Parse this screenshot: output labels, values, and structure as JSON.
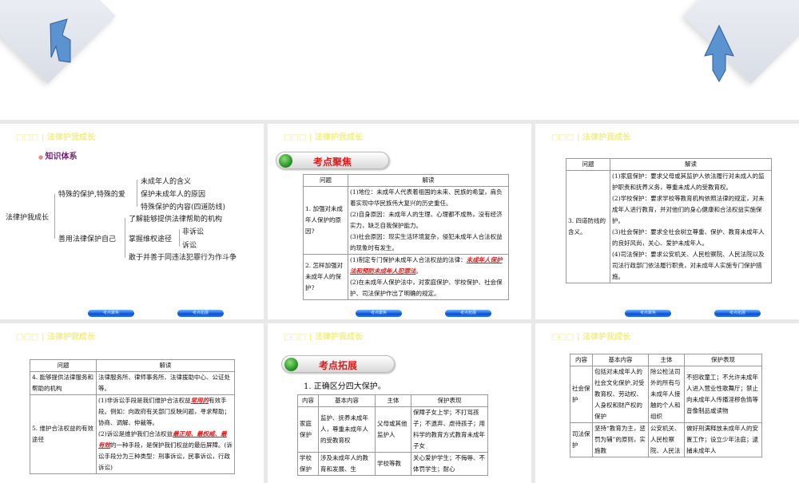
{
  "header": "□□□ | 法律护我成长",
  "nav": {
    "prev": "考点聚焦",
    "next": "考点拓展"
  },
  "slide1": {
    "section": "知识体系",
    "root": "法律护我成长",
    "b1": "特殊的保护,特殊的爱",
    "b1_items": [
      "未成年人的含义",
      "保护未成年人的原因",
      "特殊保护的内容(四道防线)"
    ],
    "b2": "善用法律保护自己",
    "b2_items": [
      "了解能够提供法律帮助的机构",
      "掌握维权途径",
      "敢于并善于同违法犯罪行为作斗争"
    ],
    "b2_sub": [
      "非诉讼",
      "诉讼"
    ]
  },
  "slide2": {
    "banner": "考点聚焦",
    "head": [
      "问题",
      "解读"
    ],
    "r1q": "1. 加强对未成年人保护的原因?",
    "r1a": [
      "(1)地位：未成年人代表着祖国的未来、民族的希望，肩负着实现中华民族伟大复兴的历史重任。",
      "(2)自身原因：未成年人的生理、心理都不成熟，没有经济实力，缺乏自我保护能力。",
      "(3)社会原因：现实生活环境复杂，侵犯未成年人合法权益的现象时有发生。"
    ],
    "r2q": "2. 怎样加强对未成年人的保护?",
    "r2a1": "(1)制定专门保护未成年人合法权益的法律：",
    "r2a1_red": "未成年人保护法和预防未成年人犯罪法",
    "r2a1_end": "。",
    "r2a2": "(2)在未成年人保护法中，对家庭保护、学校保护、社会保护、司法保护作出了明确的规定。"
  },
  "slide3": {
    "head": [
      "问题",
      "解读"
    ],
    "q": "3. 四道防线的含义。",
    "a": [
      "(1)家庭保护：要求父母或其监护人依法履行对未成人的监护职责和抚养义务，尊重未成人的受教育权。",
      "(2)学校保护：要求学校等教育机构依照法律的规定，对未成年人进行教育，并对他们的身心健康和合法权益实施保护。",
      "(3)社会保护：要求全社会树立尊重、保护、教育未成年人的良好风尚，关心、爱护未成年人。",
      "(4)司法保护：要求公安机关、人民检察院、人民法院以及司法行政部门依法履行职责，对未成年人实施专门保护措施。"
    ]
  },
  "slide4": {
    "head": [
      "问题",
      "解读"
    ],
    "r4q": "4. 能够提供法律服务和帮助的机构",
    "r4a": "法律服务所、律师事务所、法律援助中心、公证处等。",
    "r5q": "5. 维护合法权益的有效途径",
    "r5a1": "(1)非诉讼手段是我们维护合法权益",
    "r5a1_red": "常用的",
    "r5a1_end": "有效手段。例如：向政府有关部门反映问题，寻求帮助；协商、调解、仲裁等。",
    "r5a2": "(2)诉讼是维护我们合法权益",
    "r5a2_red": "最正规、最权威、最有效",
    "r5a2_end": "的一种手段，是保护我们权益的最后屏障。(诉讼手段分为三种类型：刑事诉讼，民事诉讼，行政诉讼)"
  },
  "slide5": {
    "banner": "考点拓展",
    "intro": "1. 正确区分四大保护。",
    "head": [
      "内容",
      "基本内容",
      "主体",
      "保护表现"
    ],
    "rows": [
      [
        "家庭保护",
        "监护、抚养未成年人，尊重未成年人的受教育权",
        "父母或其他监护人",
        "保障子女上学；不打骂孩子；不遗弃、虐待孩子；用科学的教育方式教育未成年子女"
      ],
      [
        "学校保护",
        "涉及未成年人的教育和发展、生",
        "学校等教",
        "关心爱护学生；不侮辱、不体罚学生；耐心"
      ]
    ]
  },
  "slide6": {
    "head": [
      "内容",
      "基本内容",
      "主体",
      "保护表现"
    ],
    "rows": [
      [
        "社会保护",
        "包括对未成年人的社会文化保护,对受教育权、劳动权、人身权和财产权的保护",
        "除公检法司外的所有与未成年人接触的个人和组织",
        "不招收童工；不允许未成年人进入营业性歌舞厅；禁止向未成年人传播淫秽色情等音像制品或读物"
      ],
      [
        "司法保护",
        "坚持“教育为主，惩罚为辅”的原则，实施教",
        "公安机关、人民检察院、人民法",
        "做好刑满释放未成年人的安置工作；设立少年法庭；逮捕未成年人"
      ]
    ]
  }
}
